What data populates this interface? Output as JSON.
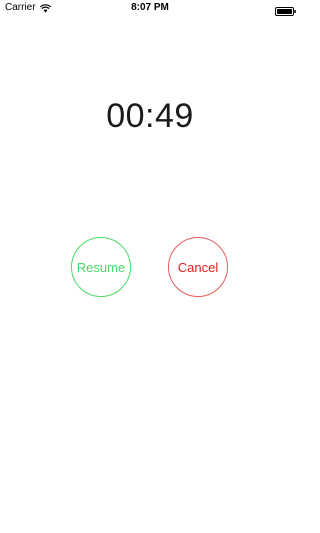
{
  "status_bar": {
    "carrier": "Carrier",
    "time": "8:07 PM",
    "wifi_icon": "wifi-icon",
    "battery_icon": "battery-icon"
  },
  "timer": {
    "display": "00:49"
  },
  "buttons": {
    "resume_label": "Resume",
    "cancel_label": "Cancel",
    "resume_color": "#4cd964",
    "cancel_color": "#e02020"
  }
}
